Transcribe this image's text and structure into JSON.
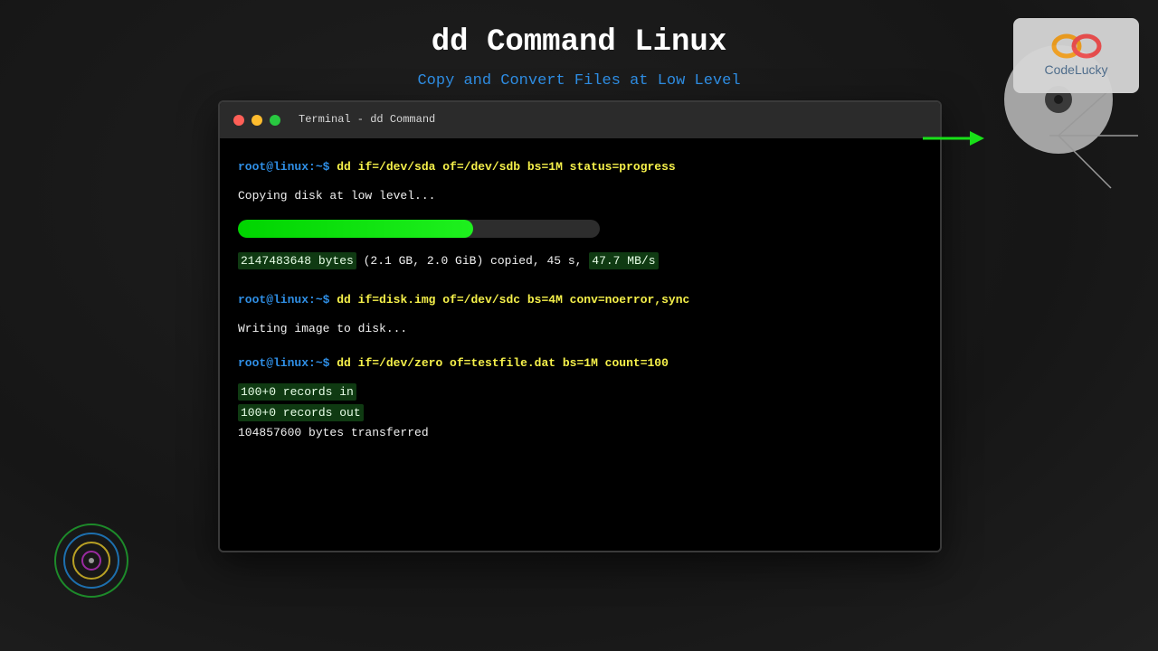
{
  "header": {
    "title": "dd Command Linux",
    "subtitle": "Copy and Convert Files at Low Level"
  },
  "terminal": {
    "window_title": "Terminal - dd Command",
    "prompt": "root@linux:~$",
    "cmd1": "dd if=/dev/sda of=/dev/sdb bs=1M status=progress",
    "out1": "Copying disk at low level...",
    "progress": 0.65,
    "stat_bytes": "2147483648 bytes",
    "stat_mid": " (2.1 GB, 2.0 GiB) copied, 45 s, ",
    "stat_rate": "47.7 MB/s",
    "cmd2": "dd if=disk.img of=/dev/sdc bs=4M conv=noerror,sync",
    "out2": "Writing image to disk...",
    "cmd3": "dd if=/dev/zero of=testfile.dat bs=1M count=100",
    "records_in": "100+0 records in",
    "records_out": "100+0 records out",
    "transferred": "104857600 bytes transferred"
  },
  "logo": {
    "text": "CodeLucky"
  },
  "icons": {
    "window_controls": [
      "close-dot-icon",
      "minimize-dot-icon",
      "maximize-dot-icon"
    ],
    "disk": "disk-icon",
    "arrow": "arrow-right-icon",
    "radar": "radar-circles-icon"
  },
  "colors": {
    "prompt": "#2f8fe6",
    "command": "#f5f04a",
    "progress": "#00d400",
    "highlight_bg": "#0f3a12"
  }
}
